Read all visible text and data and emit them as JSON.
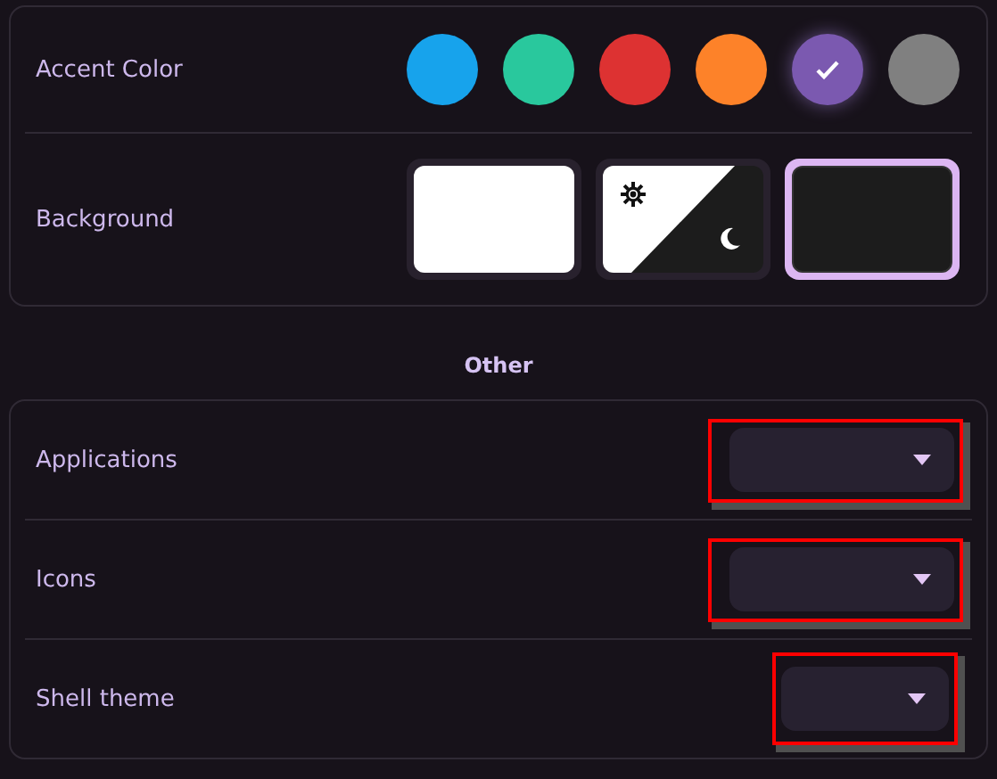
{
  "appearance": {
    "rows": [
      {
        "kind": "accent",
        "label": "Accent Color",
        "colors": [
          {
            "color": "#17a3ec",
            "selected": false
          },
          {
            "color": "#29c89d",
            "selected": false
          },
          {
            "color": "#dd3232",
            "selected": false
          },
          {
            "color": "#fd8229",
            "selected": false
          },
          {
            "color": "#7b59b0",
            "selected": true
          },
          {
            "color": "#808080",
            "selected": false
          }
        ]
      },
      {
        "kind": "background",
        "label": "Background",
        "options": [
          {
            "kind": "light",
            "selected": false
          },
          {
            "kind": "auto",
            "selected": false
          },
          {
            "kind": "dark",
            "selected": true
          }
        ]
      }
    ]
  },
  "other": {
    "heading": "Other",
    "rows": [
      {
        "label": "Applications",
        "dropdown": {
          "kind": "wide",
          "highlighted": true
        }
      },
      {
        "label": "Icons",
        "dropdown": {
          "kind": "wide",
          "highlighted": true
        }
      },
      {
        "label": "Shell theme",
        "dropdown": {
          "kind": "narrow",
          "highlighted": true
        }
      }
    ]
  }
}
